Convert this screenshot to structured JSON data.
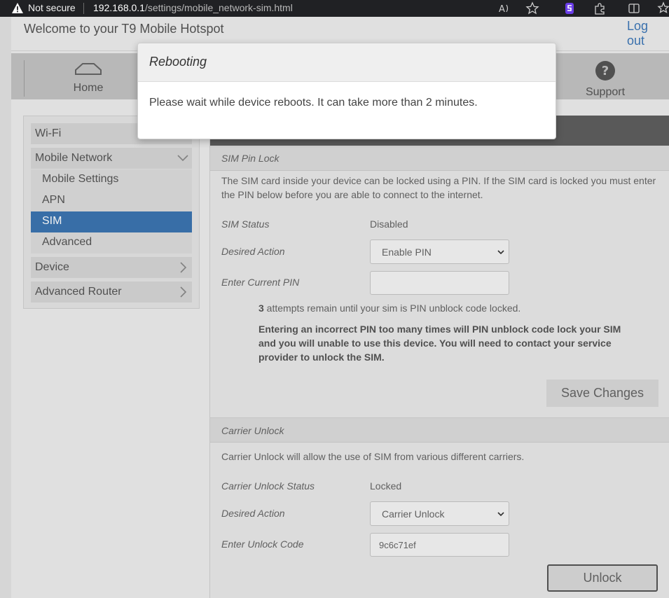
{
  "browser": {
    "security_label": "Not secure",
    "url_host": "192.168.0.1",
    "url_path": "/settings/mobile_network-sim.html"
  },
  "header": {
    "welcome": "Welcome to your T9 Mobile Hotspot",
    "logout": "Log out",
    "nav": {
      "home": "Home",
      "support": "Support"
    }
  },
  "sidebar": {
    "wifi": "Wi-Fi",
    "mobile_network": "Mobile Network",
    "mobile_settings": "Mobile Settings",
    "apn": "APN",
    "sim": "SIM",
    "advanced": "Advanced",
    "device": "Device",
    "advanced_router": "Advanced Router"
  },
  "sim_pin_lock": {
    "title": "SIM Pin Lock",
    "description": "The SIM card inside your device can be locked using a PIN. If the SIM card is locked you must enter the PIN below before you are able to connect to the internet.",
    "status_label": "SIM Status",
    "status_value": "Disabled",
    "action_label": "Desired Action",
    "action_value": "Enable PIN",
    "pin_label": "Enter Current PIN",
    "pin_value": "",
    "attempts_count": "3",
    "attempts_text": " attempts remain until your sim is PIN unblock code locked.",
    "warning": "Entering an incorrect PIN too many times will PIN unblock code lock your SIM and you will unable to use this device. You will need to contact your service provider to unlock the SIM.",
    "save_button": "Save Changes"
  },
  "carrier_unlock": {
    "title": "Carrier Unlock",
    "description": "Carrier Unlock will allow the use of SIM from various different carriers.",
    "status_label": "Carrier Unlock Status",
    "status_value": "Locked",
    "action_label": "Desired Action",
    "action_value": "Carrier Unlock",
    "code_label": "Enter Unlock Code",
    "code_value": "9c6c71ef",
    "unlock_button": "Unlock"
  },
  "modal": {
    "title": "Rebooting",
    "message": "Please wait while device reboots. It can take more than 2 minutes."
  },
  "colors": {
    "accent": "#3b74b0",
    "content_header": "#5e5e5e",
    "browser_bar": "#202124"
  }
}
